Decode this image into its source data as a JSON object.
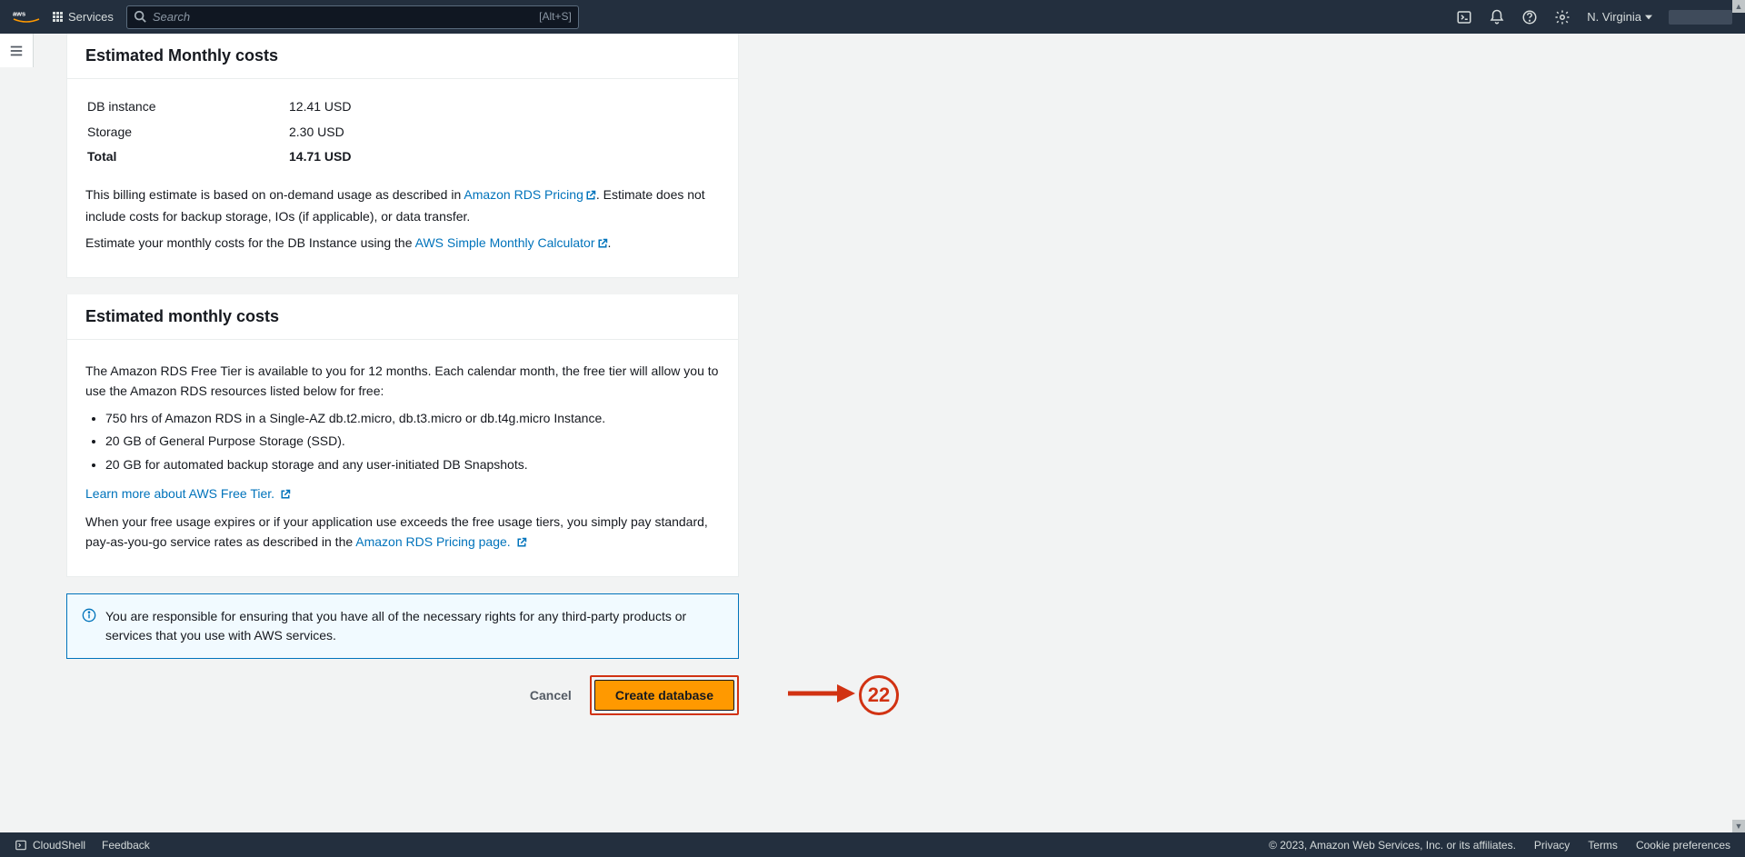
{
  "nav": {
    "services": "Services",
    "search_placeholder": "Search",
    "alt_s": "[Alt+S]",
    "region": "N. Virginia"
  },
  "panel1": {
    "title": "Estimated Monthly costs",
    "rows": {
      "r0_label": "DB instance",
      "r0_val": "12.41 USD",
      "r1_label": "Storage",
      "r1_val": "2.30 USD",
      "r2_label": "Total",
      "r2_val": "14.71 USD"
    },
    "para1_a": "This billing estimate is based on on-demand usage as described in ",
    "link1": "Amazon RDS Pricing",
    "para1_b": ". Estimate does not include costs for backup storage, IOs (if applicable), or data transfer.",
    "para2_a": "Estimate your monthly costs for the DB Instance using the ",
    "link2": "AWS Simple Monthly Calculator",
    "para2_b": "."
  },
  "panel2": {
    "title": "Estimated monthly costs",
    "intro": "The Amazon RDS Free Tier is available to you for 12 months. Each calendar month, the free tier will allow you to use the Amazon RDS resources listed below for free:",
    "li0": "750 hrs of Amazon RDS in a Single-AZ db.t2.micro, db.t3.micro or db.t4g.micro Instance.",
    "li1": "20 GB of General Purpose Storage (SSD).",
    "li2": "20 GB for automated backup storage and any user-initiated DB Snapshots.",
    "learn_link": "Learn more about AWS Free Tier.",
    "outro_a": "When your free usage expires or if your application use exceeds the free usage tiers, you simply pay standard, pay-as-you-go service rates as described in the ",
    "outro_link": "Amazon RDS Pricing page.",
    "outro_b": ""
  },
  "info": {
    "text": "You are responsible for ensuring that you have all of the necessary rights for any third-party products or services that you use with AWS services."
  },
  "buttons": {
    "cancel": "Cancel",
    "create": "Create database"
  },
  "annotation": {
    "step": "22"
  },
  "footer": {
    "cloudshell": "CloudShell",
    "feedback": "Feedback",
    "copyright": "© 2023, Amazon Web Services, Inc. or its affiliates.",
    "privacy": "Privacy",
    "terms": "Terms",
    "cookies": "Cookie preferences"
  }
}
